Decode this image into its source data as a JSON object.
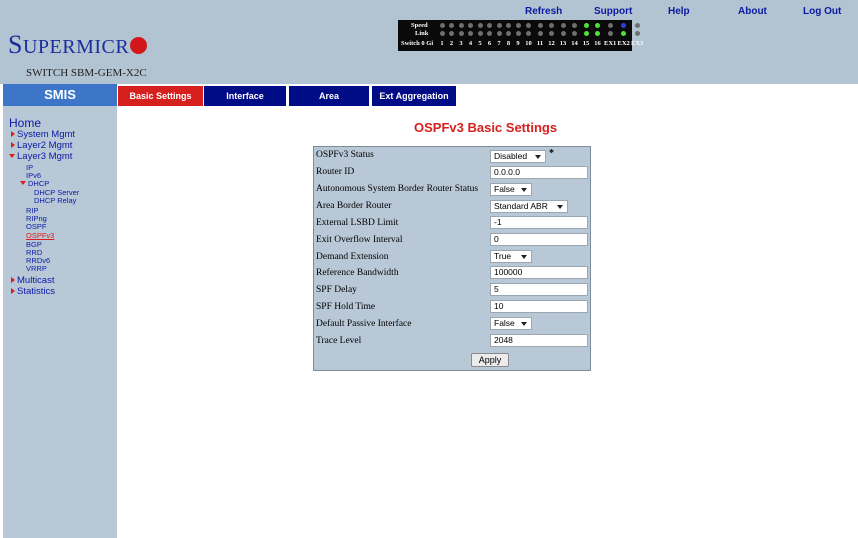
{
  "top_links": [
    "Refresh",
    "Support",
    "Help",
    "About",
    "Log Out"
  ],
  "logo": {
    "first": "S",
    "rest": "UPERMICR"
  },
  "model": "SWITCH SBM-GEM-X2C",
  "port_panel": {
    "speed_label": "Speed",
    "link_label": "Link",
    "row_label": "Switch 0 Gi",
    "ports": [
      "1",
      "2",
      "3",
      "4",
      "5",
      "6",
      "7",
      "8",
      "9",
      "10",
      "11",
      "12",
      "13",
      "14",
      "15",
      "16",
      "EX1",
      "EX2",
      "EX3"
    ]
  },
  "nav": {
    "smis_label": "SMIS",
    "tabs": [
      "Basic Settings",
      "Interface",
      "Area",
      "Ext Aggregation"
    ]
  },
  "sidebar": {
    "home": "Home",
    "system_mgmt": "System Mgmt",
    "layer2_mgmt": "Layer2 Mgmt",
    "layer3_mgmt": "Layer3 Mgmt",
    "ip": "IP",
    "ipv6": "IPv6",
    "dhcp": "DHCP",
    "dhcp_server": "DHCP Server",
    "dhcp_relay": "DHCP Relay",
    "rip": "RIP",
    "ripng": "RIPng",
    "ospf": "OSPF",
    "ospfv3": "OSPFv3",
    "bgp": "BGP",
    "rrd": "RRD",
    "rrdv6": "RRDv6",
    "vrrp": "VRRP",
    "multicast": "Multicast",
    "statistics": "Statistics"
  },
  "main": {
    "title": "OSPFv3 Basic Settings",
    "fields": [
      {
        "label": "OSPFv3 Status",
        "value": "Disabled"
      },
      {
        "label": "Router ID",
        "value": "0.0.0.0"
      },
      {
        "label": "Autonomous System Border Router Status",
        "value": "False"
      },
      {
        "label": "Area Border Router",
        "value": "Standard ABR"
      },
      {
        "label": "External LSBD Limit",
        "value": "-1"
      },
      {
        "label": "Exit Overflow Interval",
        "value": "0"
      },
      {
        "label": "Demand Extension",
        "value": "True"
      },
      {
        "label": "Reference Bandwidth",
        "value": "100000"
      },
      {
        "label": "SPF Delay",
        "value": "5"
      },
      {
        "label": "SPF Hold Time",
        "value": "10"
      },
      {
        "label": "Default Passive Interface",
        "value": "False"
      },
      {
        "label": "Trace Level",
        "value": "2048"
      }
    ],
    "required_mark": "*",
    "apply_label": "Apply"
  },
  "colors": {
    "header_bg": "#b2c3d1",
    "sidebar_bg": "#b8c8d6",
    "active_tab": "#d6201e",
    "inactive_tab": "#000b86",
    "smis_bg": "#3d76c9",
    "link_color": "#0c1aa8"
  }
}
